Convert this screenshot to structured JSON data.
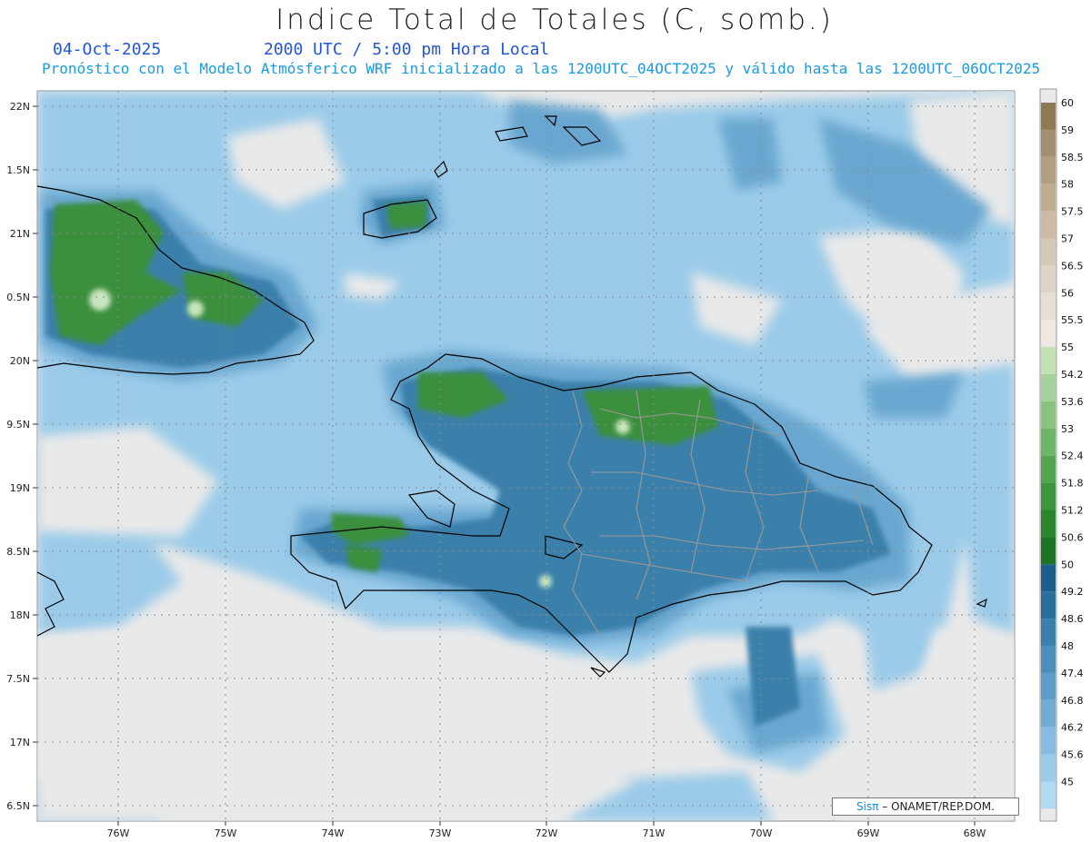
{
  "header": {
    "title": "Indice Total de Totales (C, somb.)",
    "date": "04-Oct-2025",
    "time": "2000 UTC / 5:00 pm Hora Local",
    "subtitle": "Pronóstico con el Modelo Atmósferico WRF inicializado a las 1200UTC_04OCT2025 y válido hasta las  1200UTC_06OCT2025"
  },
  "map": {
    "lat_labels": [
      "22N",
      "1.5N",
      "21N",
      "0.5N",
      "20N",
      "9.5N",
      "19N",
      "8.5N",
      "18N",
      "7.5N",
      "17N",
      "6.5N"
    ],
    "lon_labels": [
      "76W",
      "75W",
      "74W",
      "73W",
      "72W",
      "71W",
      "70W",
      "69W",
      "68W"
    ],
    "extent": {
      "lon_min": -76.7,
      "lon_max": -67.6,
      "lat_min": 16.4,
      "lat_max": 22.1
    }
  },
  "colorbar": {
    "labels": [
      "60",
      "59",
      "58.5",
      "58",
      "57.5",
      "57",
      "56.5",
      "56",
      "55.5",
      "55",
      "54.2",
      "53.6",
      "53",
      "52.4",
      "51.8",
      "51.2",
      "50.6",
      "50",
      "49.2",
      "48.6",
      "48",
      "47.4",
      "46.8",
      "46.2",
      "45.6",
      "45"
    ],
    "colors": [
      "#8d7a55",
      "#a39070",
      "#b29f83",
      "#bfad93",
      "#cbbba4",
      "#d6c8b6",
      "#dfd5c7",
      "#e7dfd5",
      "#eeeae3",
      "#c3e0b6",
      "#a6d19a",
      "#8ac380",
      "#6db568",
      "#53a552",
      "#3d953f",
      "#2b852f",
      "#1d7424",
      "#1b5f8a",
      "#2a6f9b",
      "#3b80ab",
      "#4d8fbb",
      "#5f9dc8",
      "#72acd4",
      "#86bce0",
      "#9bcbe9",
      "#b0d9f2"
    ]
  },
  "credit": {
    "brand": "Sisπ",
    "text": " – ONAMET/REP.DOM."
  }
}
